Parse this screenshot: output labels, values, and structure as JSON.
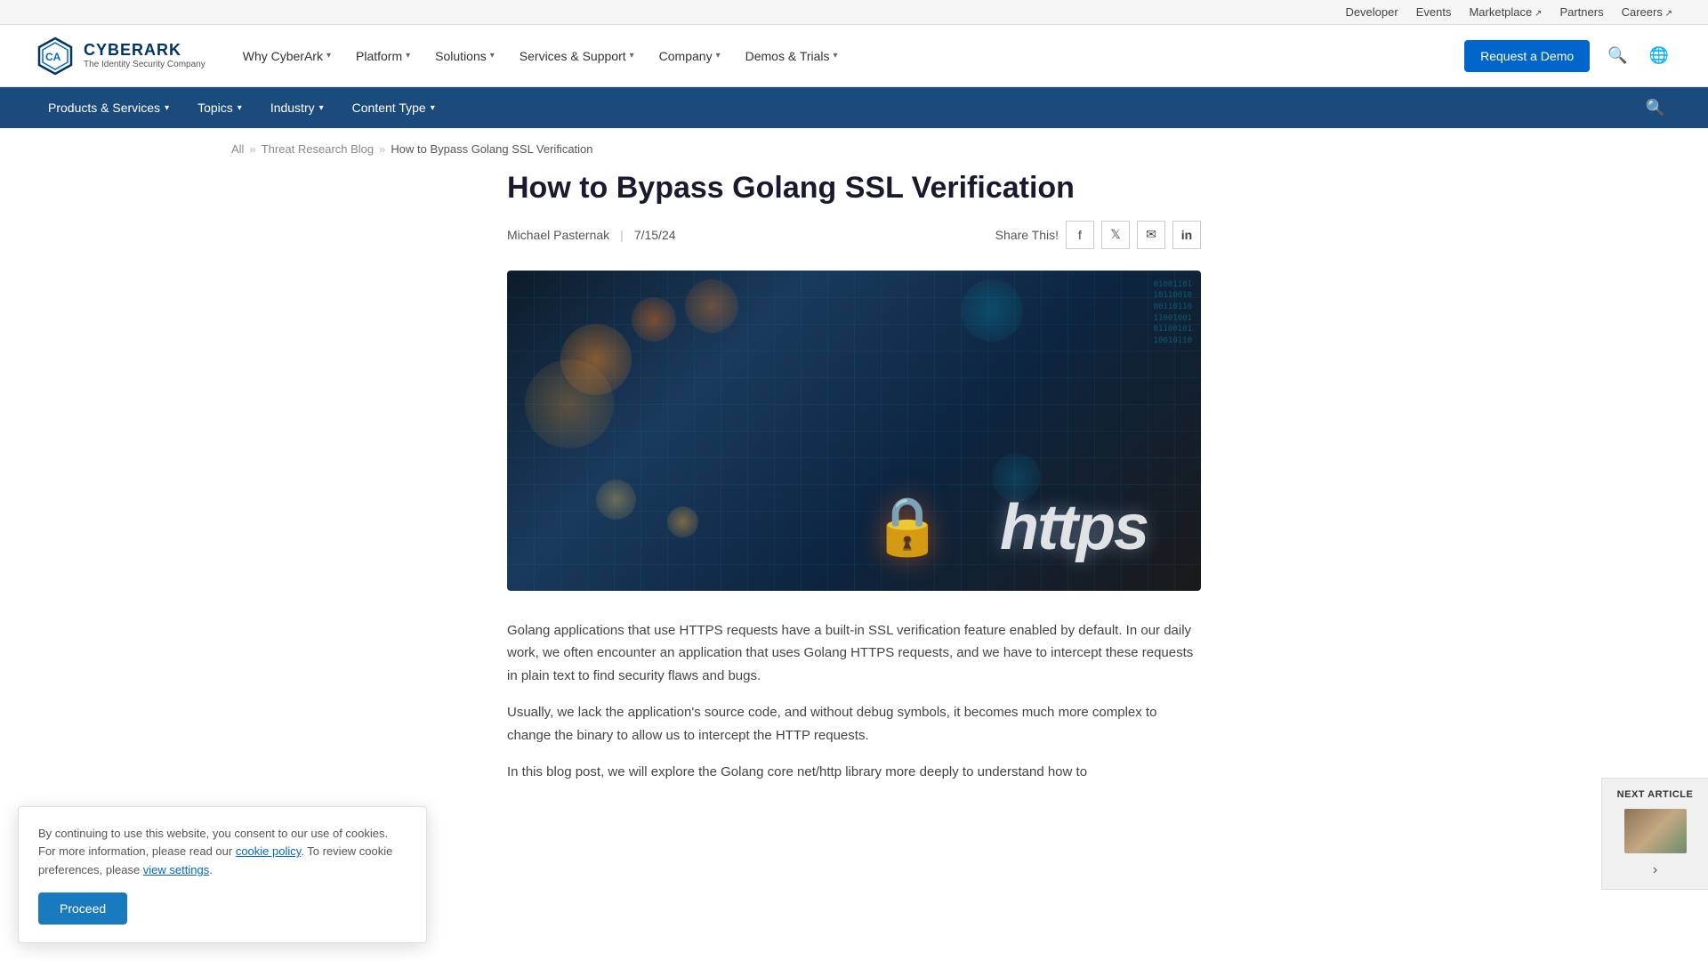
{
  "utility_bar": {
    "links": [
      {
        "label": "Developer",
        "external": false
      },
      {
        "label": "Events",
        "external": false
      },
      {
        "label": "Marketplace",
        "external": true
      },
      {
        "label": "Partners",
        "external": false
      },
      {
        "label": "Careers",
        "external": true
      }
    ]
  },
  "main_nav": {
    "logo_name": "CYBERARK",
    "logo_tagline": "The Identity Security Company",
    "items": [
      {
        "label": "Why CyberArk",
        "has_dropdown": true
      },
      {
        "label": "Platform",
        "has_dropdown": true
      },
      {
        "label": "Solutions",
        "has_dropdown": true
      },
      {
        "label": "Services & Support",
        "has_dropdown": true
      },
      {
        "label": "Company",
        "has_dropdown": true
      },
      {
        "label": "Demos & Trials",
        "has_dropdown": true
      }
    ],
    "demo_button": "Request a Demo"
  },
  "secondary_nav": {
    "items": [
      {
        "label": "Products & Services",
        "has_dropdown": true
      },
      {
        "label": "Topics",
        "has_dropdown": true
      },
      {
        "label": "Industry",
        "has_dropdown": true
      },
      {
        "label": "Content Type",
        "has_dropdown": true
      }
    ]
  },
  "breadcrumb": {
    "items": [
      {
        "label": "All",
        "link": true
      },
      {
        "label": "Threat Research Blog",
        "link": true
      },
      {
        "label": "How to Bypass Golang SSL Verification",
        "link": false
      }
    ]
  },
  "article": {
    "title": "How to Bypass Golang SSL Verification",
    "author": "Michael Pasternak",
    "date": "7/15/24",
    "share_label": "Share This!",
    "share_buttons": [
      {
        "platform": "facebook",
        "icon": "f"
      },
      {
        "platform": "twitter",
        "icon": "𝕏"
      },
      {
        "platform": "email",
        "icon": "✉"
      },
      {
        "platform": "linkedin",
        "icon": "in"
      }
    ],
    "body_paragraphs": [
      "Golang applications that use HTTPS requests have a built-in SSL verification feature enabled by default. In our daily work, we often encounter an application that uses Golang HTTPS requests, and we have to intercept these requests in plain text to find security flaws and bugs.",
      "Usually, we lack the application's source code, and without debug symbols, it becomes much more complex to change the binary to allow us to intercept the HTTP requests.",
      "In this blog post, we will explore the Golang core net/http library more deeply to understand how to"
    ]
  },
  "cookie_banner": {
    "text_before_link1": "By continuing to use this website, you consent to our use of cookies. For more information, please read our ",
    "link1_label": "cookie policy",
    "text_between": ". To review cookie preferences, please ",
    "link2_label": "view settings",
    "text_after": ".",
    "proceed_label": "Proceed"
  },
  "next_article": {
    "label": "NEXT ARTICLE",
    "arrow": "›"
  }
}
